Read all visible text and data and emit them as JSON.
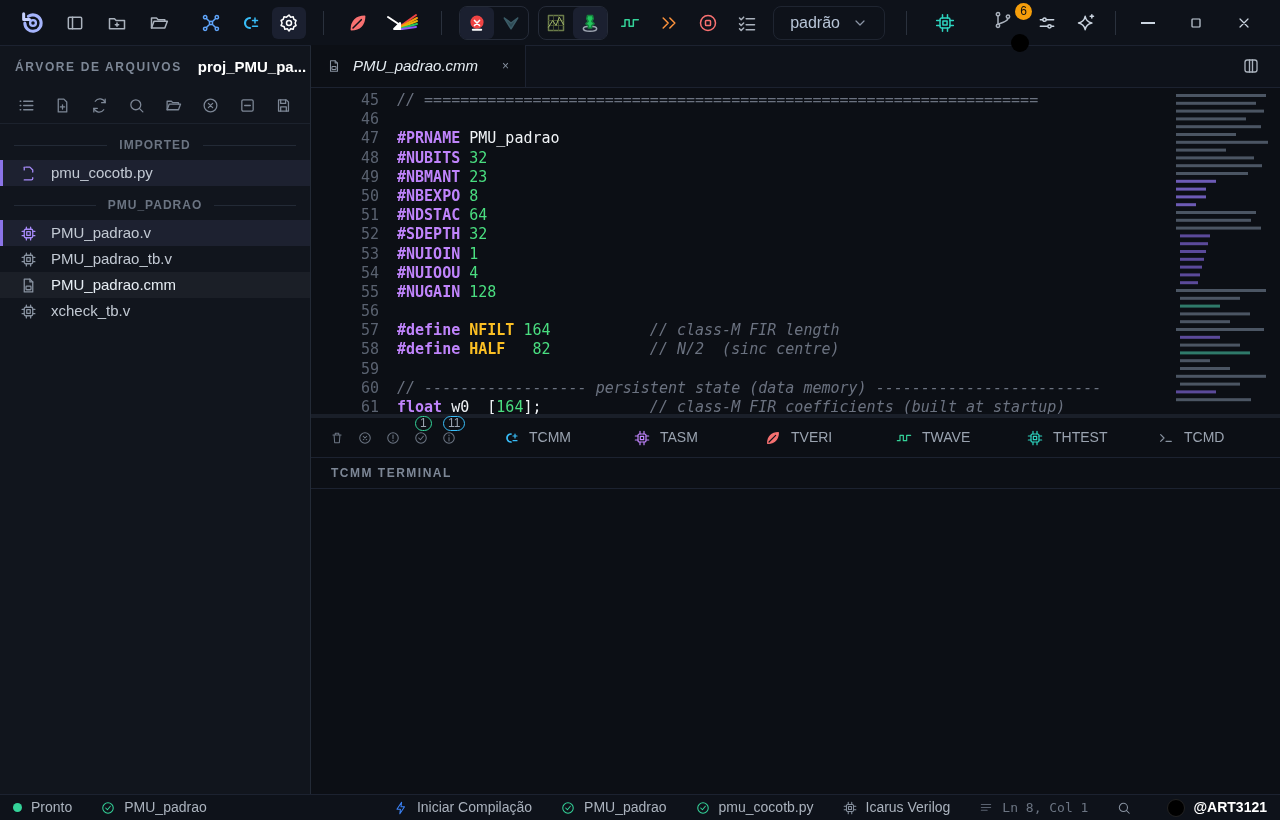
{
  "toolbar": {
    "left": [
      {
        "kind": "logo"
      },
      {
        "kind": "sidebar"
      },
      {
        "kind": "new-folder"
      },
      {
        "kind": "open-folder"
      }
    ],
    "tools": [
      {
        "kind": "graph",
        "selected": false
      },
      {
        "kind": "cpm",
        "selected": false
      },
      {
        "kind": "gear",
        "selected": true
      },
      {
        "kind": "leaf",
        "selected": false
      },
      {
        "kind": "prism",
        "selected": false
      }
    ],
    "group": [
      {
        "kind": "bug",
        "selected": true
      },
      {
        "kind": "vee",
        "selected": false
      },
      {
        "kind": "scope",
        "selected": false
      },
      {
        "kind": "figure",
        "selected": true
      }
    ],
    "tools2": [
      {
        "kind": "wave",
        "selected": false
      },
      {
        "kind": "chevrons",
        "selected": false
      },
      {
        "kind": "stop",
        "selected": false
      },
      {
        "kind": "checklist",
        "selected": false
      }
    ],
    "profile": "padrão",
    "right": [
      {
        "kind": "chip"
      },
      {
        "kind": "branch",
        "badge": "6"
      },
      {
        "kind": "sliders"
      },
      {
        "kind": "sparkle"
      }
    ]
  },
  "sidebar": {
    "title": "ÁRVORE DE ARQUIVOS",
    "project": "proj_PMU_pa...",
    "sections": [
      {
        "label": "IMPORTED",
        "items": [
          {
            "name": "pmu_cocotb.py",
            "kind": "python",
            "selected": true,
            "open": false
          }
        ]
      },
      {
        "label": "PMU_PADRAO",
        "items": [
          {
            "name": "PMU_padrao.v",
            "kind": "chip",
            "selected": true,
            "open": false
          },
          {
            "name": "PMU_padrao_tb.v",
            "kind": "chip",
            "selected": false,
            "open": false
          },
          {
            "name": "PMU_padrao.cmm",
            "kind": "cmm",
            "selected": false,
            "open": true
          },
          {
            "name": "xcheck_tb.v",
            "kind": "chip",
            "selected": false,
            "open": false
          }
        ]
      }
    ]
  },
  "editor": {
    "tab": "PMU_padrao.cmm",
    "close": "×",
    "lines": [
      {
        "number": "45",
        "tokens": [
          {
            "kind": "comment",
            "text": "// ===================================================================="
          }
        ]
      },
      {
        "number": "46"
      },
      {
        "number": "47",
        "tokens": [
          {
            "kind": "directive",
            "text": "#PRNAME"
          },
          {
            "kind": "name",
            "text": " PMU_padrao"
          }
        ]
      },
      {
        "number": "48",
        "tokens": [
          {
            "kind": "directive",
            "text": "#NUBITS"
          },
          {
            "kind": "number",
            "text": " 32"
          }
        ]
      },
      {
        "number": "49",
        "tokens": [
          {
            "kind": "directive",
            "text": "#NBMANT"
          },
          {
            "kind": "number",
            "text": " 23"
          }
        ]
      },
      {
        "number": "50",
        "tokens": [
          {
            "kind": "directive",
            "text": "#NBEXPO"
          },
          {
            "kind": "number",
            "text": " 8"
          }
        ]
      },
      {
        "number": "51",
        "tokens": [
          {
            "kind": "directive",
            "text": "#NDSTAC"
          },
          {
            "kind": "number",
            "text": " 64"
          }
        ]
      },
      {
        "number": "52",
        "tokens": [
          {
            "kind": "directive",
            "text": "#SDEPTH"
          },
          {
            "kind": "number",
            "text": " 32"
          }
        ]
      },
      {
        "number": "53",
        "tokens": [
          {
            "kind": "directive",
            "text": "#NUIOIN"
          },
          {
            "kind": "number",
            "text": " 1"
          }
        ]
      },
      {
        "number": "54",
        "tokens": [
          {
            "kind": "directive",
            "text": "#NUIOOU"
          },
          {
            "kind": "number",
            "text": " 4"
          }
        ]
      },
      {
        "number": "55",
        "tokens": [
          {
            "kind": "directive",
            "text": "#NUGAIN"
          },
          {
            "kind": "number",
            "text": " 128"
          }
        ]
      },
      {
        "number": "56"
      },
      {
        "number": "57",
        "tokens": [
          {
            "kind": "directive",
            "text": "#define"
          },
          {
            "kind": "macro",
            "text": " NFILT"
          },
          {
            "kind": "number",
            "text": " 164"
          },
          {
            "kind": "comment",
            "text": "           // class-M FIR length"
          }
        ]
      },
      {
        "number": "58",
        "tokens": [
          {
            "kind": "directive",
            "text": "#define"
          },
          {
            "kind": "macro",
            "text": " HALF"
          },
          {
            "kind": "number",
            "text": "   82"
          },
          {
            "kind": "comment",
            "text": "           // N/2  (sinc centre)"
          }
        ]
      },
      {
        "number": "59"
      },
      {
        "number": "60",
        "tokens": [
          {
            "kind": "comment",
            "text": "// ------------------ persistent state (data memory) -------------------------"
          }
        ]
      },
      {
        "number": "61",
        "tokens": [
          {
            "kind": "directive",
            "text": "float"
          },
          {
            "kind": "name",
            "text": " w0  ["
          },
          {
            "kind": "number",
            "text": "164"
          },
          {
            "kind": "name",
            "text": "];"
          },
          {
            "kind": "comment",
            "text": "            // class-M FIR coefficients (built at startup)"
          }
        ]
      }
    ]
  },
  "panel": {
    "counts": [
      {
        "kind": "passed",
        "text": "1"
      },
      {
        "kind": "info",
        "text": "11"
      }
    ],
    "tabs": [
      {
        "kind": "cpm",
        "label": "TCMM"
      },
      {
        "kind": "chip",
        "label": "TASM"
      },
      {
        "kind": "leaf",
        "label": "TVERI"
      },
      {
        "kind": "wave",
        "label": "TWAVE"
      },
      {
        "kind": "chip2",
        "label": "THTEST"
      },
      {
        "kind": "prompt",
        "label": "TCMD"
      }
    ],
    "heading": "TCMM TERMINAL"
  },
  "status_bar": {
    "left": [
      {
        "kind": "dot",
        "text": "Pronto"
      },
      {
        "kind": "check",
        "text": "PMU_padrao"
      }
    ],
    "right": [
      {
        "kind": "bolt",
        "text": "Iniciar Compilação"
      },
      {
        "kind": "check",
        "text": "PMU_padrao"
      },
      {
        "kind": "check",
        "text": "pmu_cocotb.py"
      },
      {
        "kind": "chip",
        "text": "Icarus Verilog"
      },
      {
        "kind": "lines",
        "text": "Ln 8, Col 1"
      },
      {
        "kind": "search"
      }
    ],
    "user": "@ART3121"
  }
}
